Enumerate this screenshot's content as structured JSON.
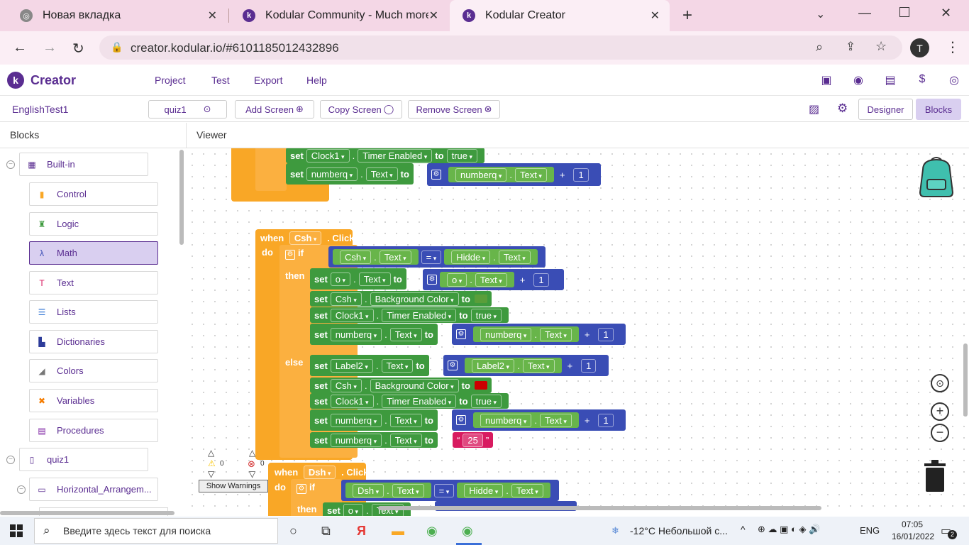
{
  "browser": {
    "tabs": [
      {
        "title": "Новая вкладка",
        "active": false
      },
      {
        "title": "Kodular Community - Much more",
        "active": false
      },
      {
        "title": "Kodular Creator",
        "active": true
      }
    ],
    "url": "creator.kodular.io/#6101185012432896",
    "profile_initial": "T"
  },
  "app": {
    "brand": "Creator",
    "menu": [
      "Project",
      "Test",
      "Export",
      "Help"
    ],
    "project": "EnglishTest1",
    "screen": "quiz1",
    "add_screen": "Add Screen",
    "copy_screen": "Copy Screen",
    "remove_screen": "Remove Screen",
    "designer": "Designer",
    "blocks": "Blocks"
  },
  "panels": {
    "blocks_title": "Blocks",
    "viewer_title": "Viewer"
  },
  "tree": {
    "builtin": "Built-in",
    "items": [
      "Control",
      "Logic",
      "Math",
      "Text",
      "Lists",
      "Dictionaries",
      "Colors",
      "Variables",
      "Procedures"
    ],
    "selected": "Math",
    "screen_node": "quiz1",
    "child_node": "Horizontal_Arrangem..."
  },
  "blocks": {
    "set": "set",
    "to": "to",
    "when": "when",
    "do": "do",
    "if": "if",
    "then": "then",
    "else": "else",
    "plus": "+",
    "eq": "=",
    "click": "Click",
    "dot": ".",
    "clock1": "Clock1",
    "timer_enabled": "Timer Enabled",
    "true": "true",
    "numberq": "numberq",
    "text": "Text",
    "one": "1",
    "csh": "Csh",
    "hidde": "Hidde",
    "o": "o",
    "bg_color": "Background Color",
    "label2": "Label2",
    "dsh": "Dsh",
    "twentyfive": "25",
    "green_color": "#5a9e3a",
    "red_color": "#cc0000"
  },
  "warnings": {
    "warn_count": "0",
    "error_count": "0",
    "show_label": "Show Warnings"
  },
  "taskbar": {
    "search_placeholder": "Введите здесь текст для поиска",
    "weather": "-12°C  Небольшой с...",
    "lang": "ENG",
    "time": "07:05",
    "date": "16/01/2022",
    "notif": "2"
  }
}
